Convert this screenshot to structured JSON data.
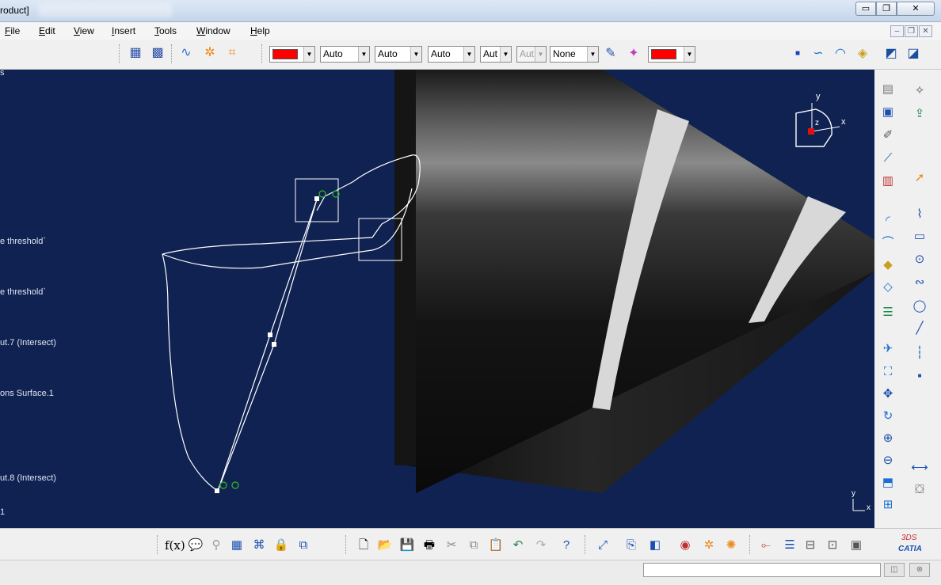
{
  "window": {
    "title": "roduct]",
    "controls": {
      "minimize": "▭",
      "maximize": "❐",
      "close": "✕"
    }
  },
  "menu": {
    "items": [
      "File",
      "Edit",
      "View",
      "Insert",
      "Tools",
      "Window",
      "Help"
    ],
    "mdi_controls": [
      "–",
      "❐",
      "✕"
    ]
  },
  "toolbar": {
    "combos": {
      "color1": {
        "value": "",
        "color": "#ff0000"
      },
      "linetype": {
        "value": "Auto"
      },
      "thickness": {
        "value": "Auto"
      },
      "linetype2": {
        "value": "Auto"
      },
      "point": {
        "value": "Aut"
      },
      "transparency": {
        "value": "Aut"
      },
      "layer": {
        "value": "None"
      },
      "color2": {
        "value": "",
        "color": "#ff0000"
      }
    },
    "icons": [
      "grid-icon",
      "snap-grid-icon",
      "sketch-analysis-icon",
      "repair-icon",
      "dimension-icon",
      "paint-brush-icon",
      "format-painter-icon",
      "point-marker-icon",
      "spline-icon",
      "surface-icon",
      "plane-icon",
      "multi-view-icon",
      "multi-view-2-icon"
    ]
  },
  "viewport": {
    "background": "#0f2251",
    "tree_labels": [
      {
        "text": "s"
      },
      {
        "text": "e threshold`"
      },
      {
        "text": "e threshold`"
      },
      {
        "text": "ut.7 (Intersect)"
      },
      {
        "text": "ons Surface.1"
      },
      {
        "text": "ut.8 (Intersect)"
      },
      {
        "text": "1"
      }
    ],
    "compass": {
      "x_label": "x",
      "y_label": "y",
      "z_label": "z"
    },
    "mini_axis": {
      "x_label": "x",
      "y_label": "y"
    }
  },
  "right_toolbar": {
    "icons": [
      "constraint-icon",
      "sketch-icon",
      "profile-icon",
      "arc-icon",
      "rectangle-icon",
      "circle-icon",
      "spline-icon",
      "ellipse-icon",
      "line-icon",
      "axis-icon",
      "point-icon",
      "fit-all-icon",
      "pan-icon",
      "rotate-icon",
      "zoom-in-icon",
      "zoom-out-icon",
      "normal-view-icon",
      "multi-view-icon",
      "select-icon",
      "exit-workbench-icon",
      "measure-icon",
      "trim-icon",
      "chamfer-icon",
      "transform-icon",
      "project-icon"
    ]
  },
  "bottom_toolbar": {
    "icons": [
      "formula-icon",
      "comment-icon",
      "lock-icon",
      "table-icon",
      "tree-icon",
      "sketch-lock-icon",
      "knowledge-icon",
      "new-icon",
      "open-icon",
      "save-icon",
      "print-icon",
      "cut-icon",
      "copy-icon",
      "paste-icon",
      "undo-icon",
      "redo-icon",
      "help-icon",
      "fly-mode-icon",
      "view-mode-icon",
      "shading-icon",
      "hide-show-icon",
      "swap-icon",
      "quick-select-icon",
      "tools-icon",
      "spec-tree-icon",
      "catalog-icon",
      "analysis-icon",
      "measure-icon"
    ],
    "catia_logo_text": "CATIA",
    "catia_logo_prefix": "3DS"
  },
  "status_bar": {
    "command_value": ""
  }
}
